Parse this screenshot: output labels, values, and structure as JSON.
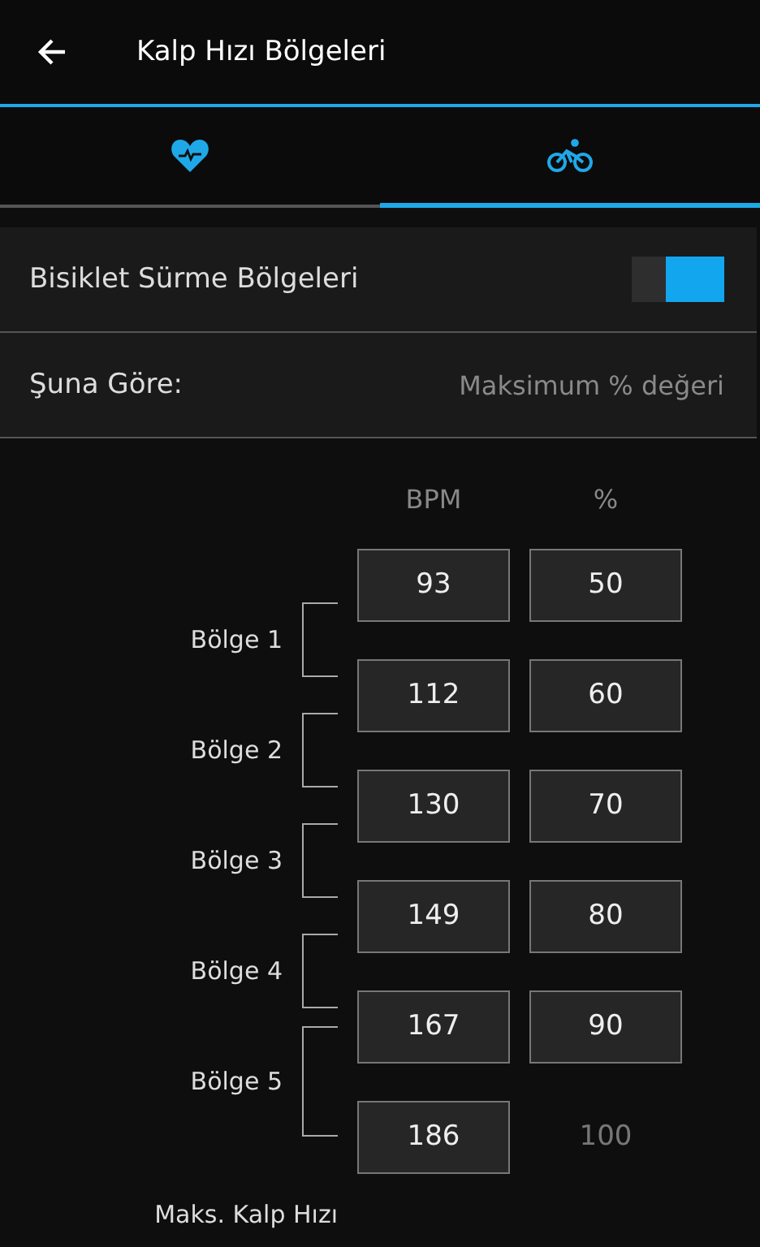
{
  "header": {
    "title": "Kalp Hızı Bölgeleri"
  },
  "tabs": [
    {
      "kind": "heart",
      "selected": false
    },
    {
      "kind": "bike",
      "selected": true
    }
  ],
  "settings": [
    {
      "kind": "toggle",
      "label": "Bisiklet Sürme Bölgeleri",
      "on": true
    },
    {
      "kind": "value",
      "label": "Şuna Göre:",
      "value": "Maksimum % değeri"
    }
  ],
  "columns": [
    "BPM",
    "%"
  ],
  "rows": [
    {
      "kind": "zone",
      "bpm": "93",
      "percent": "50"
    },
    {
      "kind": "zone",
      "bpm": "112",
      "percent": "60"
    },
    {
      "kind": "zone",
      "bpm": "130",
      "percent": "70"
    },
    {
      "kind": "zone",
      "bpm": "149",
      "percent": "80"
    },
    {
      "kind": "zone",
      "bpm": "167",
      "percent": "90"
    },
    {
      "kind": "max",
      "bpm": "186",
      "percent": "100"
    }
  ],
  "zones": [
    "Bölge 1",
    "Bölge 2",
    "Bölge 3",
    "Bölge 4",
    "Bölge 5"
  ],
  "max_label": "Maks. Kalp Hızı"
}
